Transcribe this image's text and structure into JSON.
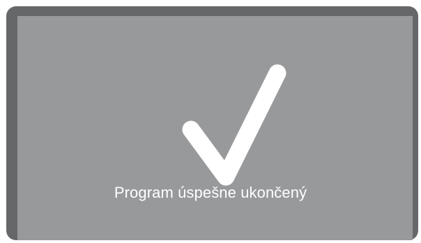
{
  "screen": {
    "status_message": "Program úspešne ukončený",
    "icon": "checkmark-icon",
    "colors": {
      "frame": "#666768",
      "display": "#98999b",
      "foreground": "#ffffff"
    }
  }
}
